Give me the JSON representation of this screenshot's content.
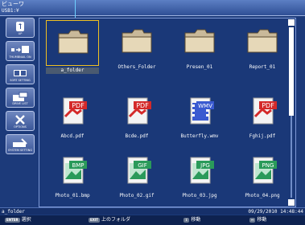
{
  "window": {
    "title": "ビューワ",
    "drive": "USB1:¥"
  },
  "sidebar": {
    "items": [
      {
        "label": "UP",
        "icon": "up-arrow-icon"
      },
      {
        "label": "THUMBNAIL ON",
        "icon": "thumbnail-icon"
      },
      {
        "label": "SORT SETTING",
        "icon": "sort-icon"
      },
      {
        "label": "DRIVE LIST",
        "icon": "drive-icon"
      },
      {
        "label": "OPTIONS",
        "icon": "tools-icon"
      },
      {
        "label": "SYSTEM SETTING",
        "icon": "system-icon"
      }
    ]
  },
  "files": [
    {
      "name": "a_folder",
      "type": "folder",
      "selected": true
    },
    {
      "name": "Others_Folder",
      "type": "folder"
    },
    {
      "name": "Presen_01",
      "type": "folder"
    },
    {
      "name": "Report_01",
      "type": "folder"
    },
    {
      "name": "Abcd.pdf",
      "type": "PDF"
    },
    {
      "name": "Bcde.pdf",
      "type": "PDF"
    },
    {
      "name": "Butterfly.wmv",
      "type": "WMV"
    },
    {
      "name": "Fghij.pdf",
      "type": "PDF"
    },
    {
      "name": "Photo_01.bmp",
      "type": "BMP"
    },
    {
      "name": "Photo_02.gif",
      "type": "GIF"
    },
    {
      "name": "Photo_03.jpg",
      "type": "JPG"
    },
    {
      "name": "Photo_04.png",
      "type": "PNG"
    }
  ],
  "status": {
    "path": "a_folder",
    "datetime": "09/29/2010  14:48:44"
  },
  "help": [
    {
      "key": "ENTER",
      "label": "選択"
    },
    {
      "key": "EXIT",
      "label": "上のフォルダ"
    },
    {
      "key": "↕",
      "label": "移動"
    },
    {
      "key": "↔",
      "label": "移動"
    }
  ],
  "colors": {
    "background": "#1c3a7a",
    "selection": "#f0c020",
    "pdf": "#d42a2a",
    "wmv": "#3a5ad0",
    "image": "#2a9a5a"
  }
}
